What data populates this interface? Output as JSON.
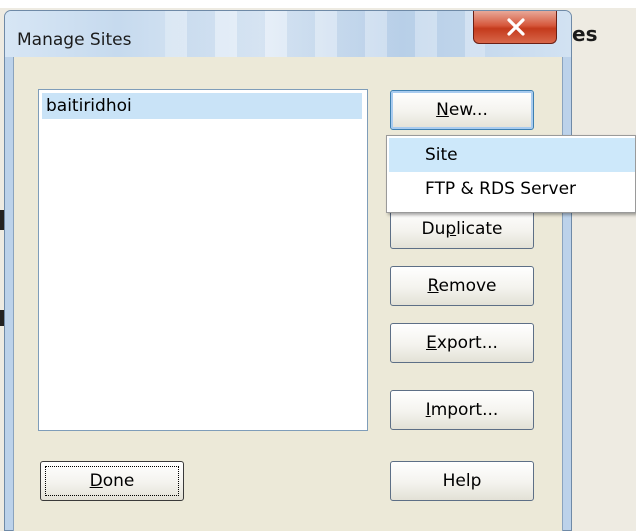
{
  "background": {
    "partial_title_text": "es"
  },
  "dialog": {
    "title": "Manage Sites",
    "close_icon": "close-icon"
  },
  "sites": {
    "items": [
      {
        "label": "baitiridhoi",
        "selected": true
      }
    ]
  },
  "buttons": {
    "new": {
      "label": "New...",
      "mnemonic": "N"
    },
    "duplicate": {
      "label": "Duplicate",
      "mnemonic": "p"
    },
    "remove": {
      "label": "Remove",
      "mnemonic": "R"
    },
    "export": {
      "label": "Export...",
      "mnemonic": "E"
    },
    "import": {
      "label": "Import...",
      "mnemonic": "I"
    },
    "done": {
      "label": "Done",
      "mnemonic": "D"
    },
    "help": {
      "label": "Help"
    }
  },
  "new_menu": {
    "items": [
      {
        "label": "Site",
        "highlighted": true
      },
      {
        "label": "FTP & RDS Server",
        "highlighted": false
      }
    ]
  },
  "colors": {
    "selection": "#c9e3f7",
    "menu_highlight": "#cde8fa",
    "close_button": "#d6583c",
    "dialog_face": "#ece9d8"
  }
}
